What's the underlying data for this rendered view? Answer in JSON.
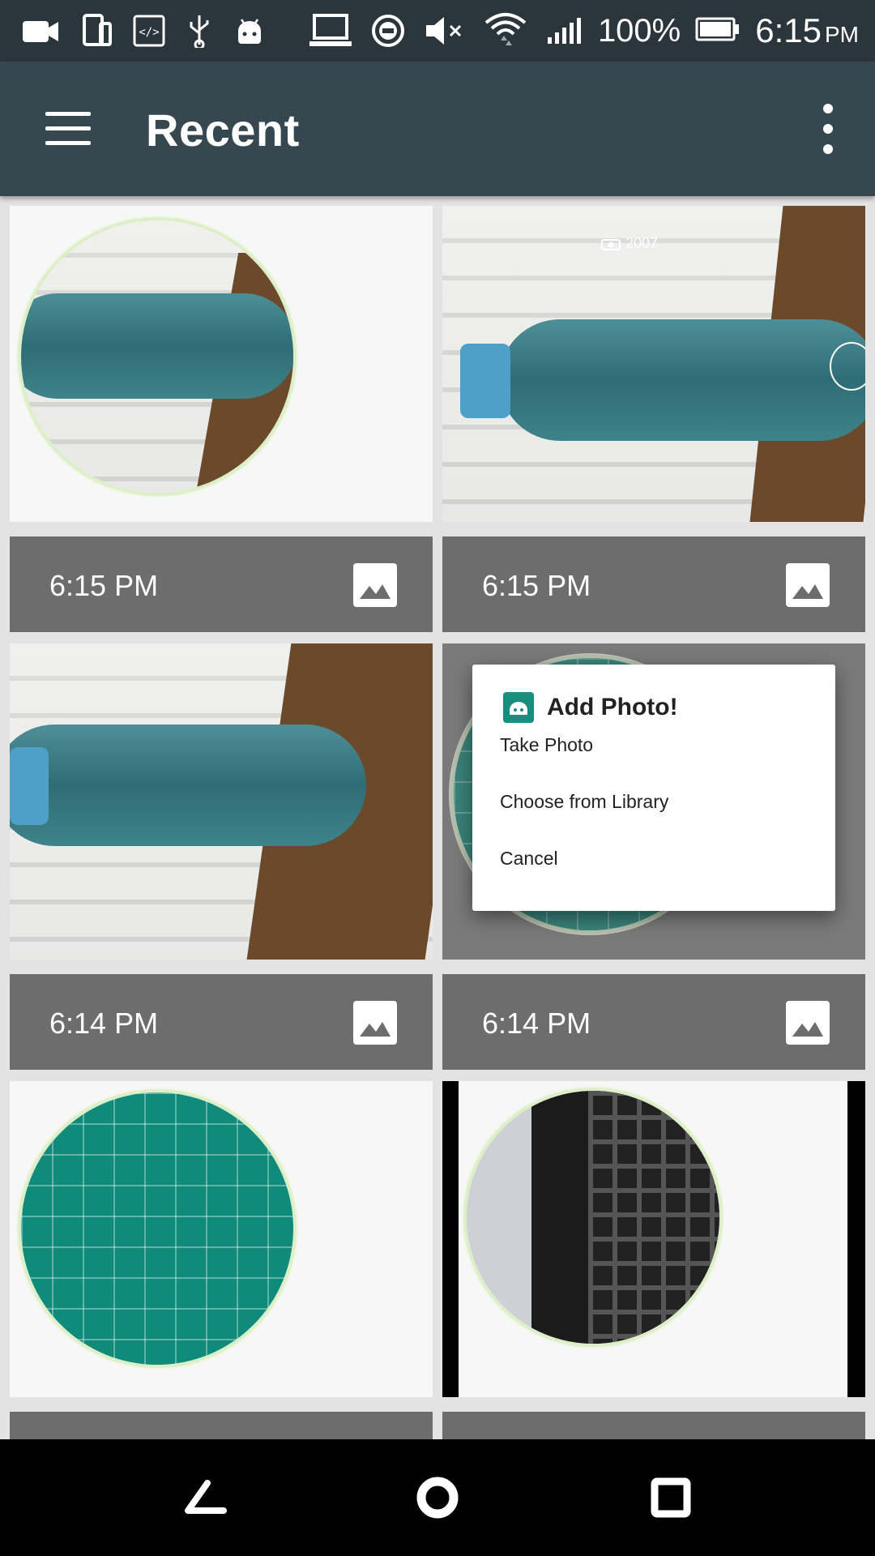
{
  "status_bar": {
    "battery_percent": "100%",
    "time": "6:15",
    "ampm": "PM",
    "icons": [
      "video-icon",
      "phone-icon",
      "code-icon",
      "usb-icon",
      "android-icon",
      "laptop-icon",
      "do-not-disturb-icon",
      "mute-icon",
      "wifi-icon",
      "signal-icon",
      "battery-icon"
    ]
  },
  "app_bar": {
    "title": "Recent",
    "menu_icon": "hamburger-icon",
    "overflow_icon": "more-vert-icon"
  },
  "grid": {
    "items": [
      {
        "time": "6:15 PM",
        "icon": "image-icon"
      },
      {
        "time": "6:15 PM",
        "icon": "image-icon",
        "overlay_text": "2007"
      },
      {
        "time": "6:14 PM",
        "icon": "image-icon"
      },
      {
        "time": "6:14 PM",
        "icon": "image-icon"
      },
      {
        "time": "",
        "icon": "image-icon"
      },
      {
        "time": "",
        "icon": "image-icon"
      }
    ]
  },
  "dialog": {
    "title": "Add Photo!",
    "options": [
      "Take Photo",
      "Choose from Library",
      "Cancel"
    ]
  },
  "nav_bar": {
    "buttons": [
      "back-icon",
      "home-icon",
      "recents-icon"
    ]
  },
  "colors": {
    "app_bar": "#37474f",
    "status_bar": "#2b353c",
    "card_footer": "#6d6d6d",
    "accent_teal": "#0f8a7b"
  }
}
